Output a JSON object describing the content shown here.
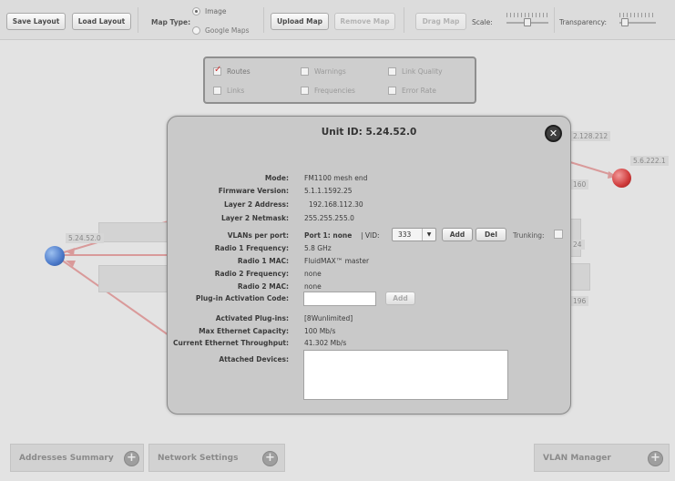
{
  "toolbar": {
    "save_layout": "Save Layout",
    "load_layout": "Load Layout",
    "map_type_label": "Map Type:",
    "map_type_options": [
      "Image",
      "Google Maps"
    ],
    "map_type_selected": "Image",
    "upload_map": "Upload Map",
    "remove_map": "Remove Map",
    "drag_map": "Drag Map",
    "scale_label": "Scale:",
    "transparency_label": "Transparency:"
  },
  "layers": {
    "items": [
      {
        "label": "Routes",
        "checked": true
      },
      {
        "label": "Warnings",
        "checked": false
      },
      {
        "label": "Link Quality",
        "checked": false
      },
      {
        "label": "Links",
        "checked": false
      },
      {
        "label": "Frequencies",
        "checked": false
      },
      {
        "label": "Error Rate",
        "checked": false
      }
    ]
  },
  "map": {
    "node_labels": [
      "5.24.52.0",
      "5.6.222.1"
    ],
    "partial_labels": [
      "2.128.212",
      "160",
      "24",
      "196"
    ]
  },
  "modal": {
    "title": "Unit ID: 5.24.52.0",
    "close": "✕",
    "fields": {
      "mode_label": "Mode:",
      "mode_value": "FM1100 mesh end",
      "firmware_label": "Firmware Version:",
      "firmware_value": "5.1.1.1592.25",
      "l2addr_label": "Layer 2 Address:",
      "l2addr_value": "192.168.112.30",
      "l2mask_label": "Layer 2 Netmask:",
      "l2mask_value": "255.255.255.0",
      "vlans_label": "VLANs per port:",
      "vlans_port": "Port 1: none",
      "vid_label": "| VID:",
      "vid_value": "333",
      "add": "Add",
      "del": "Del",
      "trunking_label": "Trunking:",
      "r1freq_label": "Radio 1 Frequency:",
      "r1freq_value": "5.8 GHz",
      "r1mac_label": "Radio 1 MAC:",
      "r1mac_value": "FluidMAX™ master",
      "r2freq_label": "Radio 2 Frequency:",
      "r2freq_value": "none",
      "r2mac_label": "Radio 2 MAC:",
      "r2mac_value": "none",
      "plugin_label": "Plug-in Activation Code:",
      "plugin_add": "Add",
      "activated_label": "Activated Plug-ins:",
      "activated_value": "[8Wunlimited]",
      "maxeth_label": "Max Ethernet Capacity:",
      "maxeth_value": "100 Mb/s",
      "curreth_label": "Current Ethernet Throughput:",
      "curreth_value": "41.302 Mb/s",
      "attached_label": "Attached Devices:"
    }
  },
  "bottom": {
    "addresses": "Addresses Summary",
    "network": "Network Settings",
    "vlan": "VLAN Manager",
    "plus": "+"
  },
  "colors": {
    "route_line": "#d99a9a",
    "node_blue": "#4a78c8",
    "node_red": "#cf3a3a"
  }
}
